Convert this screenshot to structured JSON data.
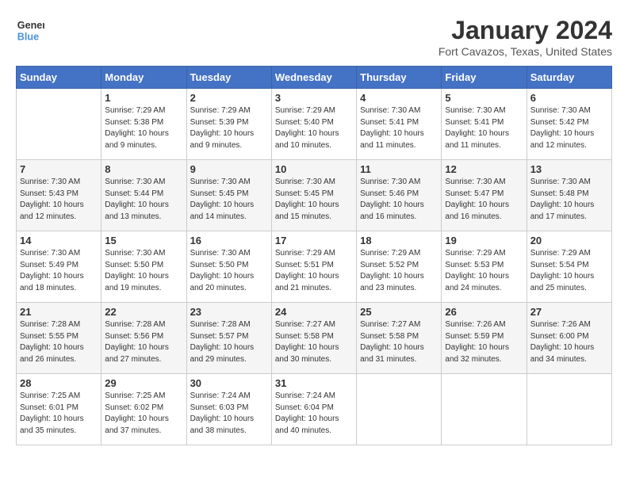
{
  "header": {
    "logo_line1": "General",
    "logo_line2": "Blue",
    "title": "January 2024",
    "subtitle": "Fort Cavazos, Texas, United States"
  },
  "days_of_week": [
    "Sunday",
    "Monday",
    "Tuesday",
    "Wednesday",
    "Thursday",
    "Friday",
    "Saturday"
  ],
  "weeks": [
    [
      {
        "day": "",
        "info": ""
      },
      {
        "day": "1",
        "info": "Sunrise: 7:29 AM\nSunset: 5:38 PM\nDaylight: 10 hours\nand 9 minutes."
      },
      {
        "day": "2",
        "info": "Sunrise: 7:29 AM\nSunset: 5:39 PM\nDaylight: 10 hours\nand 9 minutes."
      },
      {
        "day": "3",
        "info": "Sunrise: 7:29 AM\nSunset: 5:40 PM\nDaylight: 10 hours\nand 10 minutes."
      },
      {
        "day": "4",
        "info": "Sunrise: 7:30 AM\nSunset: 5:41 PM\nDaylight: 10 hours\nand 11 minutes."
      },
      {
        "day": "5",
        "info": "Sunrise: 7:30 AM\nSunset: 5:41 PM\nDaylight: 10 hours\nand 11 minutes."
      },
      {
        "day": "6",
        "info": "Sunrise: 7:30 AM\nSunset: 5:42 PM\nDaylight: 10 hours\nand 12 minutes."
      }
    ],
    [
      {
        "day": "7",
        "info": "Sunrise: 7:30 AM\nSunset: 5:43 PM\nDaylight: 10 hours\nand 12 minutes."
      },
      {
        "day": "8",
        "info": "Sunrise: 7:30 AM\nSunset: 5:44 PM\nDaylight: 10 hours\nand 13 minutes."
      },
      {
        "day": "9",
        "info": "Sunrise: 7:30 AM\nSunset: 5:45 PM\nDaylight: 10 hours\nand 14 minutes."
      },
      {
        "day": "10",
        "info": "Sunrise: 7:30 AM\nSunset: 5:45 PM\nDaylight: 10 hours\nand 15 minutes."
      },
      {
        "day": "11",
        "info": "Sunrise: 7:30 AM\nSunset: 5:46 PM\nDaylight: 10 hours\nand 16 minutes."
      },
      {
        "day": "12",
        "info": "Sunrise: 7:30 AM\nSunset: 5:47 PM\nDaylight: 10 hours\nand 16 minutes."
      },
      {
        "day": "13",
        "info": "Sunrise: 7:30 AM\nSunset: 5:48 PM\nDaylight: 10 hours\nand 17 minutes."
      }
    ],
    [
      {
        "day": "14",
        "info": "Sunrise: 7:30 AM\nSunset: 5:49 PM\nDaylight: 10 hours\nand 18 minutes."
      },
      {
        "day": "15",
        "info": "Sunrise: 7:30 AM\nSunset: 5:50 PM\nDaylight: 10 hours\nand 19 minutes."
      },
      {
        "day": "16",
        "info": "Sunrise: 7:30 AM\nSunset: 5:50 PM\nDaylight: 10 hours\nand 20 minutes."
      },
      {
        "day": "17",
        "info": "Sunrise: 7:29 AM\nSunset: 5:51 PM\nDaylight: 10 hours\nand 21 minutes."
      },
      {
        "day": "18",
        "info": "Sunrise: 7:29 AM\nSunset: 5:52 PM\nDaylight: 10 hours\nand 23 minutes."
      },
      {
        "day": "19",
        "info": "Sunrise: 7:29 AM\nSunset: 5:53 PM\nDaylight: 10 hours\nand 24 minutes."
      },
      {
        "day": "20",
        "info": "Sunrise: 7:29 AM\nSunset: 5:54 PM\nDaylight: 10 hours\nand 25 minutes."
      }
    ],
    [
      {
        "day": "21",
        "info": "Sunrise: 7:28 AM\nSunset: 5:55 PM\nDaylight: 10 hours\nand 26 minutes."
      },
      {
        "day": "22",
        "info": "Sunrise: 7:28 AM\nSunset: 5:56 PM\nDaylight: 10 hours\nand 27 minutes."
      },
      {
        "day": "23",
        "info": "Sunrise: 7:28 AM\nSunset: 5:57 PM\nDaylight: 10 hours\nand 29 minutes."
      },
      {
        "day": "24",
        "info": "Sunrise: 7:27 AM\nSunset: 5:58 PM\nDaylight: 10 hours\nand 30 minutes."
      },
      {
        "day": "25",
        "info": "Sunrise: 7:27 AM\nSunset: 5:58 PM\nDaylight: 10 hours\nand 31 minutes."
      },
      {
        "day": "26",
        "info": "Sunrise: 7:26 AM\nSunset: 5:59 PM\nDaylight: 10 hours\nand 32 minutes."
      },
      {
        "day": "27",
        "info": "Sunrise: 7:26 AM\nSunset: 6:00 PM\nDaylight: 10 hours\nand 34 minutes."
      }
    ],
    [
      {
        "day": "28",
        "info": "Sunrise: 7:25 AM\nSunset: 6:01 PM\nDaylight: 10 hours\nand 35 minutes."
      },
      {
        "day": "29",
        "info": "Sunrise: 7:25 AM\nSunset: 6:02 PM\nDaylight: 10 hours\nand 37 minutes."
      },
      {
        "day": "30",
        "info": "Sunrise: 7:24 AM\nSunset: 6:03 PM\nDaylight: 10 hours\nand 38 minutes."
      },
      {
        "day": "31",
        "info": "Sunrise: 7:24 AM\nSunset: 6:04 PM\nDaylight: 10 hours\nand 40 minutes."
      },
      {
        "day": "",
        "info": ""
      },
      {
        "day": "",
        "info": ""
      },
      {
        "day": "",
        "info": ""
      }
    ]
  ]
}
